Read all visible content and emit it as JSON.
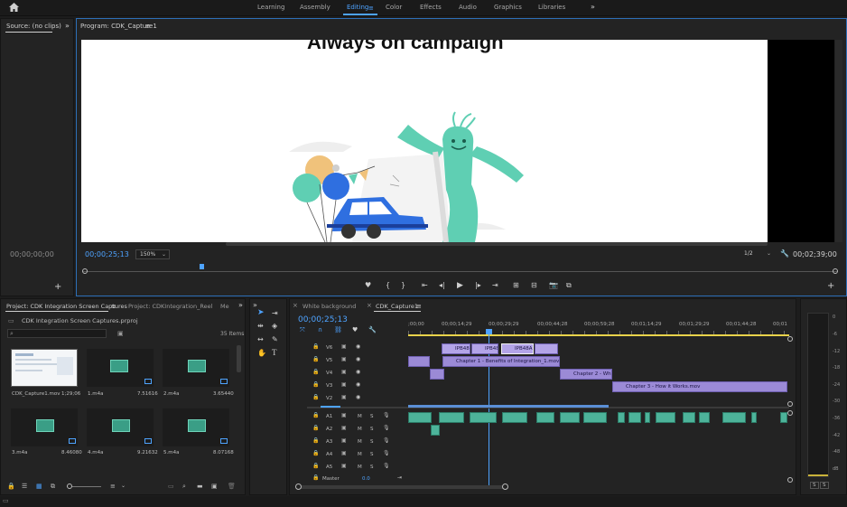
{
  "workspaces": [
    "Learning",
    "Assembly",
    "Editing",
    "Color",
    "Effects",
    "Audio",
    "Graphics",
    "Libraries"
  ],
  "active_workspace": "Editing",
  "source": {
    "tab": "Source: (no clips)",
    "timecode": "00;00;00;00"
  },
  "program": {
    "tab": "Program: CDK_Capture1",
    "video_title": "Always on campaign",
    "timecode": "00;00;25;13",
    "zoom": "150%",
    "resolution": "1/2",
    "duration": "00;02;39;00"
  },
  "project": {
    "tabs": [
      "Project: CDK Integration Screen Captures",
      "Project: CDKIntegration_Reel",
      "Me"
    ],
    "filename": "CDK Integration Screen Captures.prproj",
    "items_count": "35 Items",
    "items": [
      {
        "name": "CDK_Capture1.mov",
        "duration": "1;29;06",
        "kind": "video"
      },
      {
        "name": "1.m4a",
        "duration": "7.51616",
        "kind": "audio"
      },
      {
        "name": "2.m4a",
        "duration": "3.65440",
        "kind": "audio"
      },
      {
        "name": "3.m4a",
        "duration": "8.46080",
        "kind": "audio"
      },
      {
        "name": "4.m4a",
        "duration": "9.21632",
        "kind": "audio"
      },
      {
        "name": "5.m4a",
        "duration": "8.07168",
        "kind": "audio"
      }
    ]
  },
  "timeline": {
    "tabs": [
      "White background",
      "CDK_Capture1"
    ],
    "timecode": "00;00;25;13",
    "ruler": [
      ";00;00",
      "00;00;14;29",
      "00;00;29;29",
      "00;00;44;28",
      "00;00;59;28",
      "00;01;14;29",
      "00;01;29;29",
      "00;01;44;28",
      "00;01"
    ],
    "video_tracks": [
      "V6",
      "V5",
      "V4",
      "V3",
      "V2"
    ],
    "audio_tracks": [
      "A1",
      "A2",
      "A3",
      "A4",
      "A5"
    ],
    "master_label": "Master",
    "master_value": "0.0",
    "track_m": "M",
    "track_s": "S",
    "clips": {
      "v6": [
        "IPB48",
        "IPB48",
        "IPB48A"
      ],
      "v5": "Chapter 1 - Benefits of Integration_1.mov",
      "v4": "Chapter 2 - What",
      "v3": "Chapter 3 - How it Works.mov"
    }
  },
  "meter": {
    "scale": [
      "0",
      "-6",
      "-12",
      "-18",
      "-24",
      "-30",
      "-36",
      "-42",
      "-48",
      "dB"
    ],
    "solo": "S"
  },
  "colors": {
    "accent": "#4ea3ff",
    "clip_video": "#9b8ad6",
    "clip_audio": "#4db39a",
    "figure": "#5fcfb3"
  }
}
